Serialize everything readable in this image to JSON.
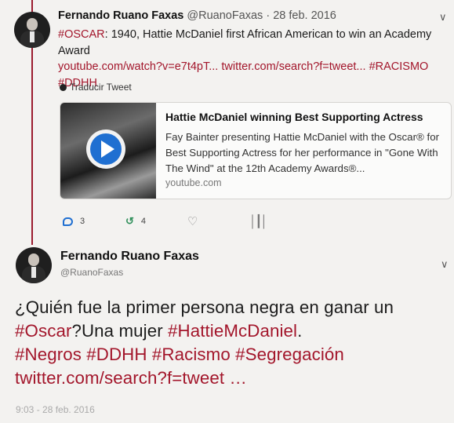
{
  "tweet1": {
    "name": "Fernando Ruano Faxas",
    "handle": "@RuanoFaxas",
    "separator": " · ",
    "date": "28 feb. 2016",
    "text_hashtag1": "#OSCAR",
    "text_body": ": 1940, Hattie McDaniel first African American to win an Academy Award",
    "link1": "youtube.com/watch?v=e7t4pT...",
    "link2": "twitter.com/search?f=tweet...",
    "hashtag2": "#RACISMO",
    "hashtag3": "#DDHH",
    "translate_label": "Traducir Tweet",
    "card": {
      "title": "Hattie McDaniel winning Best Supporting Actress",
      "description": "Fay Bainter presenting Hattie McDaniel with the Oscar® for Best Supporting Actress for her performance in \"Gone With The Wind\" at the 12th Academy Awards®...",
      "domain": "youtube.com"
    },
    "actions": {
      "replies": "3",
      "retweets": "4",
      "likes": "",
      "stats": ""
    }
  },
  "tweet2": {
    "name": "Fernando Ruano Faxas",
    "handle": "@RuanoFaxas",
    "text_plain1": "¿Quién fue la primer persona negra en ganar un ",
    "hashtag_oscar": "#Oscar",
    "text_plain2": "?Una mujer ",
    "hashtag_hattie": "#HattieMcDaniel",
    "text_plain3": ".",
    "hashtag_negros": "#Negros",
    "hashtag_ddhh": "#DDHH",
    "hashtag_racismo": "#Racismo",
    "hashtag_segregacion": "#Segregación",
    "link": "twitter.com/search?f=tweet …",
    "timestamp": "9:03 - 28 feb. 2016"
  },
  "icons": {
    "reply": "reply-icon",
    "retweet": "retweet-icon",
    "like": "heart-icon",
    "stats": "stats-icon",
    "translate": "globe-icon",
    "play": "play-icon",
    "more": "chevron-down-icon"
  },
  "colors": {
    "accent_red": "#a3162b",
    "thread_line": "#9b1b2f",
    "play_blue": "#1f6fd1",
    "retweet_green": "#2f8f5a"
  }
}
